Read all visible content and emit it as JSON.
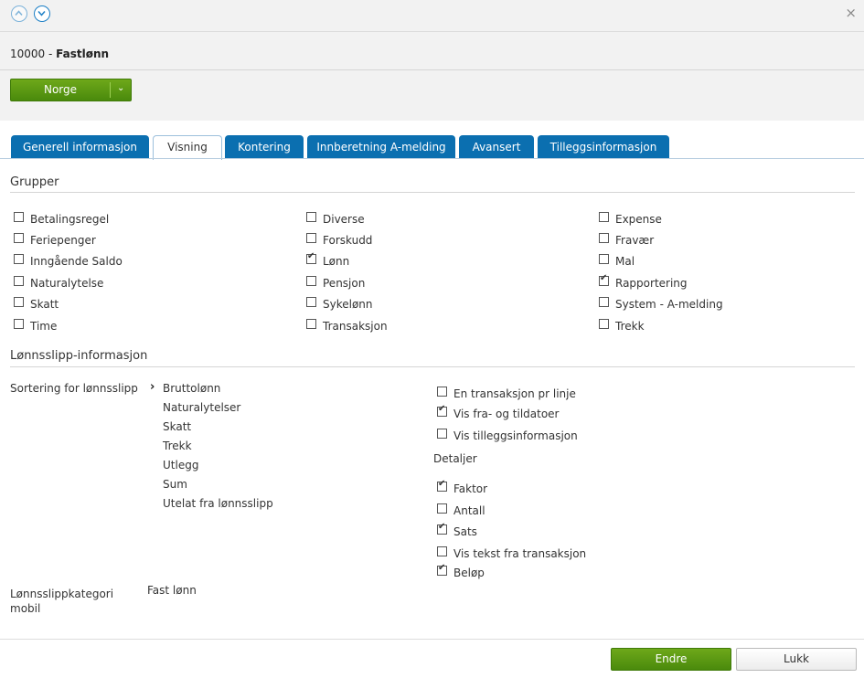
{
  "header": {
    "record_id": "10000 - ",
    "record_name": "Fastlønn",
    "close_glyph": "×",
    "country_button": "Norge",
    "country_caret": "⌄"
  },
  "tabs": [
    "Generell informasjon",
    "Visning",
    "Kontering",
    "Innberetning A-melding",
    "Avansert",
    "Tilleggsinformasjon"
  ],
  "active_tab": "Visning",
  "groups": {
    "title": "Grupper",
    "columns": [
      [
        {
          "label": "Betalingsregel",
          "checked": false
        },
        {
          "label": "Feriepenger",
          "checked": false
        },
        {
          "label": "Inngående Saldo",
          "checked": false
        },
        {
          "label": "Naturalytelse",
          "checked": false
        },
        {
          "label": "Skatt",
          "checked": false
        },
        {
          "label": "Time",
          "checked": false
        }
      ],
      [
        {
          "label": "Diverse",
          "checked": false
        },
        {
          "label": "Forskudd",
          "checked": false
        },
        {
          "label": "Lønn",
          "checked": true
        },
        {
          "label": "Pensjon",
          "checked": false
        },
        {
          "label": "Sykelønn",
          "checked": false
        },
        {
          "label": "Transaksjon",
          "checked": false
        }
      ],
      [
        {
          "label": "Expense",
          "checked": false
        },
        {
          "label": "Fravær",
          "checked": false
        },
        {
          "label": "Mal",
          "checked": false
        },
        {
          "label": "Rapportering",
          "checked": true
        },
        {
          "label": "System - A-melding",
          "checked": false
        },
        {
          "label": "Trekk",
          "checked": false
        }
      ]
    ]
  },
  "payslip": {
    "title": "Lønnsslipp-informasjon",
    "sort_label": "Sortering for lønnsslipp",
    "sort_items": [
      "Bruttolønn",
      "Naturalytelser",
      "Skatt",
      "Trekk",
      "Utlegg",
      "Sum",
      "Utelat fra lønnsslipp"
    ],
    "options": [
      {
        "label": "En transaksjon pr linje",
        "checked": false
      },
      {
        "label": "Vis fra- og tildatoer",
        "checked": true
      },
      {
        "label": "Vis tilleggsinformasjon",
        "checked": false
      }
    ],
    "details_label": "Detaljer",
    "details": [
      {
        "label": "Faktor",
        "checked": true
      },
      {
        "label": "Antall",
        "checked": false
      },
      {
        "label": "Sats",
        "checked": true
      },
      {
        "label": "Vis tekst fra transaksjon",
        "checked": false
      },
      {
        "label": "Beløp",
        "checked": true
      }
    ],
    "category_label_1": "Lønnsslippkategori",
    "category_label_2": "mobil",
    "category_value": "Fast lønn"
  },
  "footer": {
    "primary": "Endre",
    "secondary": "Lukk"
  }
}
